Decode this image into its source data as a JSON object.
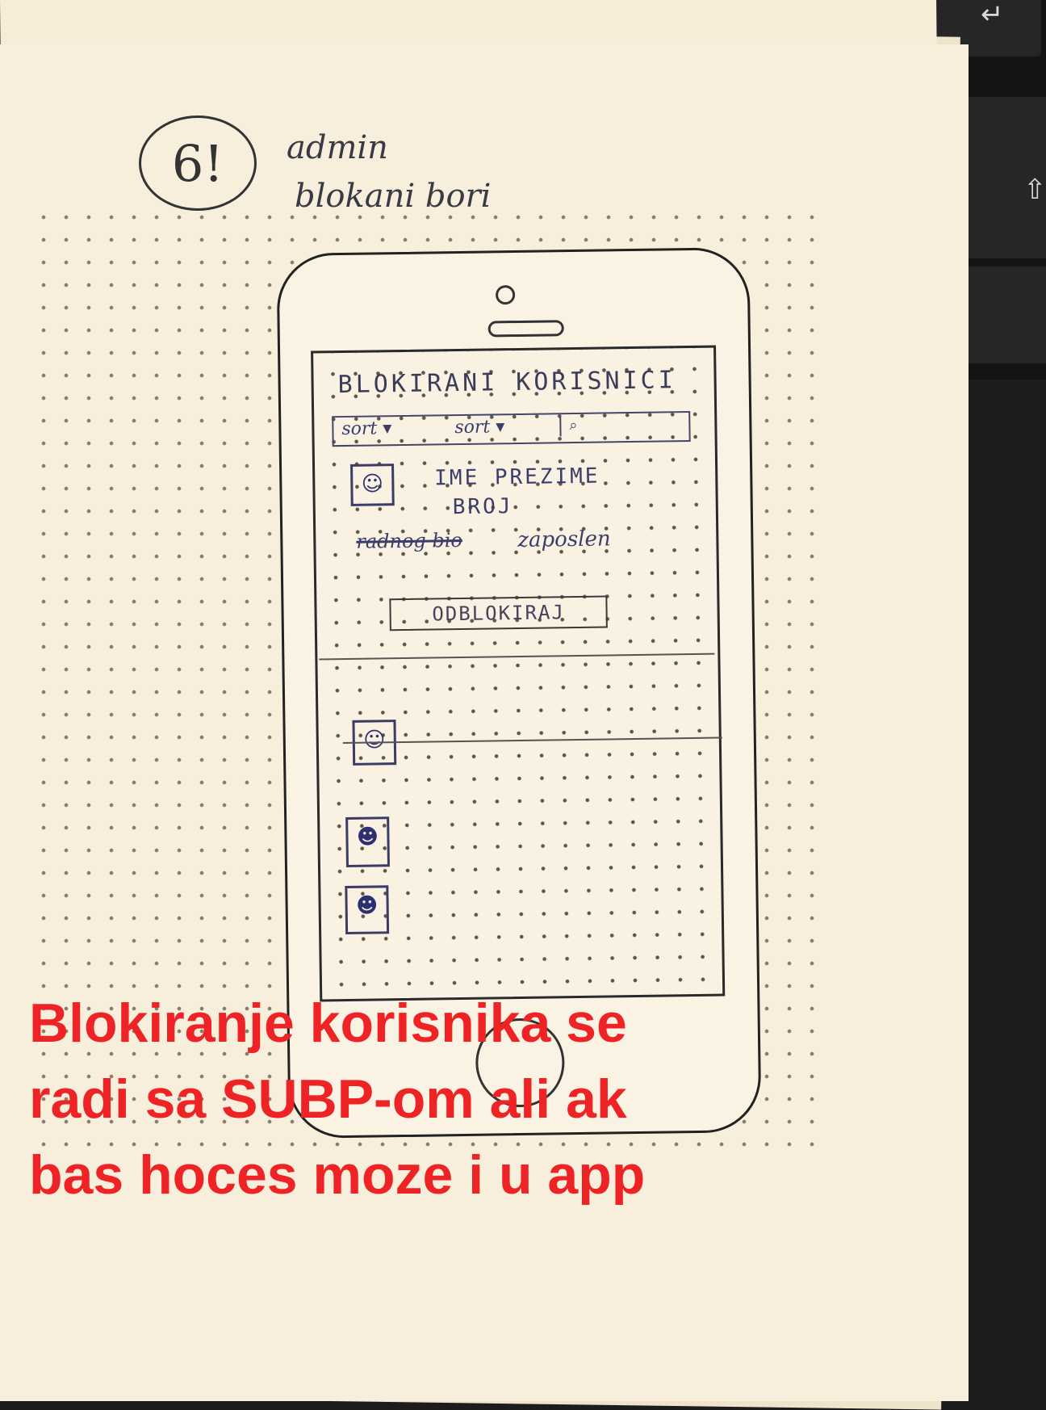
{
  "sketch": {
    "sheet_number": "6!",
    "note_line1": "admin",
    "note_line2": "blokani bori"
  },
  "phone_screen": {
    "title": "BLOKIRANI KORISNICI",
    "filters": [
      "sort ▾",
      "sort ▾"
    ],
    "search_icon": "search-icon",
    "first_user": {
      "name": "IME PREZIME",
      "number": "BROJ",
      "struck_text": "radnog bio",
      "status": "zaposlen"
    },
    "unblock_label": "ODBLOKIRAJ"
  },
  "caption": {
    "line1": "Blokiranje korisnika se",
    "line2": "radi sa SUBP-om ali ak",
    "line3": "bas hoces moze i u app"
  },
  "colors": {
    "caption": "#ee2326",
    "paper": "#f7eedc",
    "ink": "#3b3d6b"
  }
}
